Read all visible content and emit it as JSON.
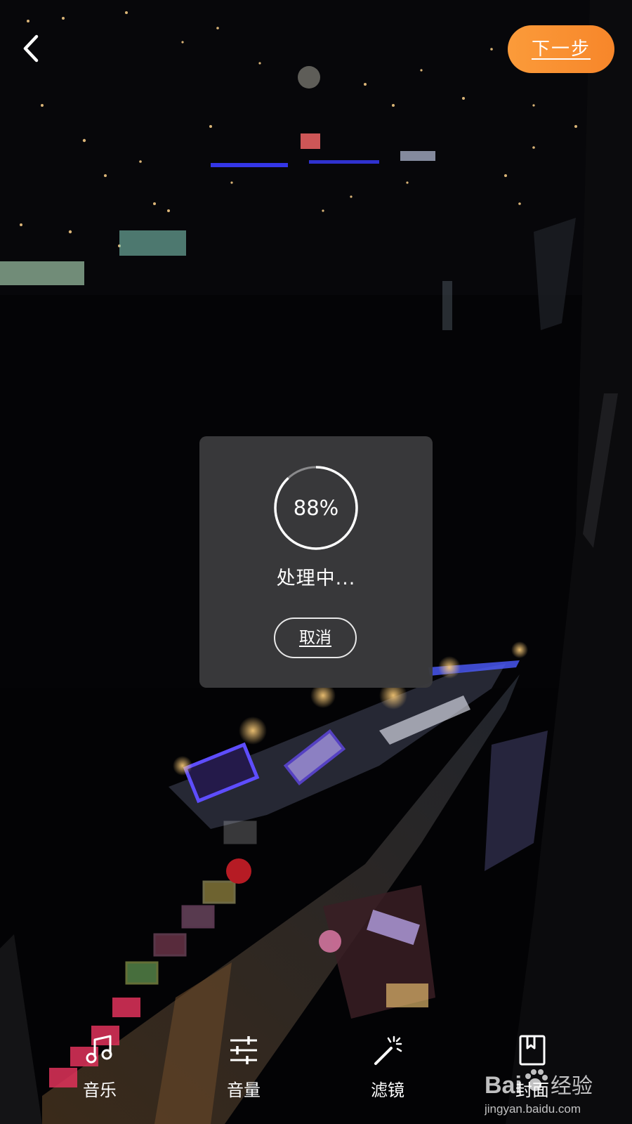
{
  "header": {
    "back_icon": "chevron-left-icon",
    "next_label": "下一步"
  },
  "dialog": {
    "progress": 88,
    "progress_label": "88%",
    "status": "处理中...",
    "cancel_label": "取消"
  },
  "toolbar": {
    "items": [
      {
        "label": "音乐",
        "icon": "music-note-icon"
      },
      {
        "label": "音量",
        "icon": "sliders-icon"
      },
      {
        "label": "滤镜",
        "icon": "magic-wand-icon"
      },
      {
        "label": "封面",
        "icon": "bookmark-icon"
      }
    ]
  },
  "watermark": {
    "text": "Bai经验",
    "url_text": "jingyan.baidu.com"
  },
  "colors": {
    "accent": "#f7862a",
    "dialog_bg": "#3a3a3c",
    "ring_progress": "#ffffff",
    "ring_track": "#8a8a8c"
  }
}
